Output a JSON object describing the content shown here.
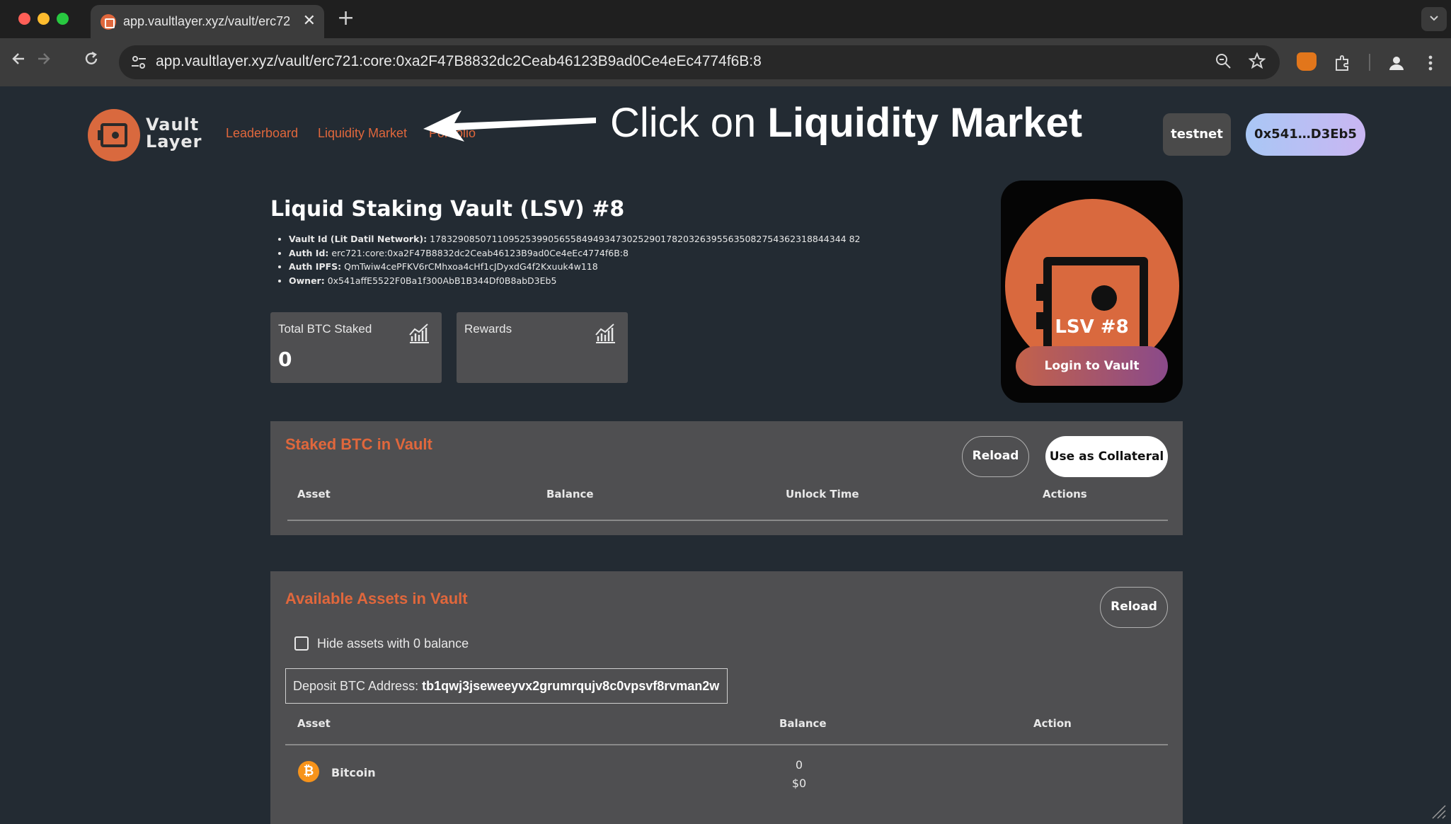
{
  "browser": {
    "tab_title": "app.vaultlayer.xyz/vault/erc72",
    "url": "app.vaultlayer.xyz/vault/erc721:core:0xa2F47B8832dc2Ceab46123B9ad0Ce4eEc4774f6B:8",
    "close_glyph": "✕",
    "new_tab_glyph": "+"
  },
  "header": {
    "logo_text": "Vault Layer",
    "nav": [
      "Leaderboard",
      "Liquidity Market",
      "Portfolio"
    ],
    "network_button": "testnet",
    "wallet_button": "0x541…D3Eb5"
  },
  "annotation": {
    "prefix": "Click on ",
    "target": "Liquidity Market"
  },
  "vault": {
    "title": "Liquid Staking Vault (LSV) #8",
    "meta": [
      {
        "label": "Vault Id (Lit Datil Network):",
        "value": "17832908507110952539905655849493473025290178203263955635082754362318844344 82"
      },
      {
        "label": "Auth Id:",
        "value": "erc721:core:0xa2F47B8832dc2Ceab46123B9ad0Ce4eEc4774f6B:8"
      },
      {
        "label": "Auth IPFS:",
        "value": "QmTwiw4cePFKV6rCMhxoa4cHf1cJDyxdG4f2Kxuuk4w118"
      },
      {
        "label": "Owner:",
        "value": "0x541affE5522F0Ba1f300AbB1B344Df0B8abD3Eb5"
      }
    ],
    "stats": [
      {
        "label": "Total BTC Staked",
        "value": "0"
      },
      {
        "label": "Rewards",
        "value": ""
      }
    ],
    "nft": {
      "label": "LSV #8",
      "login_button": "Login to Vault"
    }
  },
  "staked_panel": {
    "title": "Staked BTC in Vault",
    "reload_button": "Reload",
    "collateral_button": "Use as Collateral",
    "columns": [
      "Asset",
      "Balance",
      "Unlock Time",
      "Actions"
    ]
  },
  "available_panel": {
    "title": "Available Assets in Vault",
    "reload_button": "Reload",
    "hide_zero_label": "Hide assets with 0 balance",
    "deposit_label": "Deposit BTC Address: ",
    "deposit_address": "tb1qwj3jseweeyvx2grumrqujv8c0vpsvf8rvman2w",
    "columns": [
      "Asset",
      "Balance",
      "Action"
    ],
    "rows": [
      {
        "asset": "Bitcoin",
        "balance": "0",
        "usd": "$0"
      }
    ]
  },
  "colors": {
    "accent": "#e0673c",
    "page_bg": "#232b33",
    "panel_bg": "#4f4f51"
  }
}
